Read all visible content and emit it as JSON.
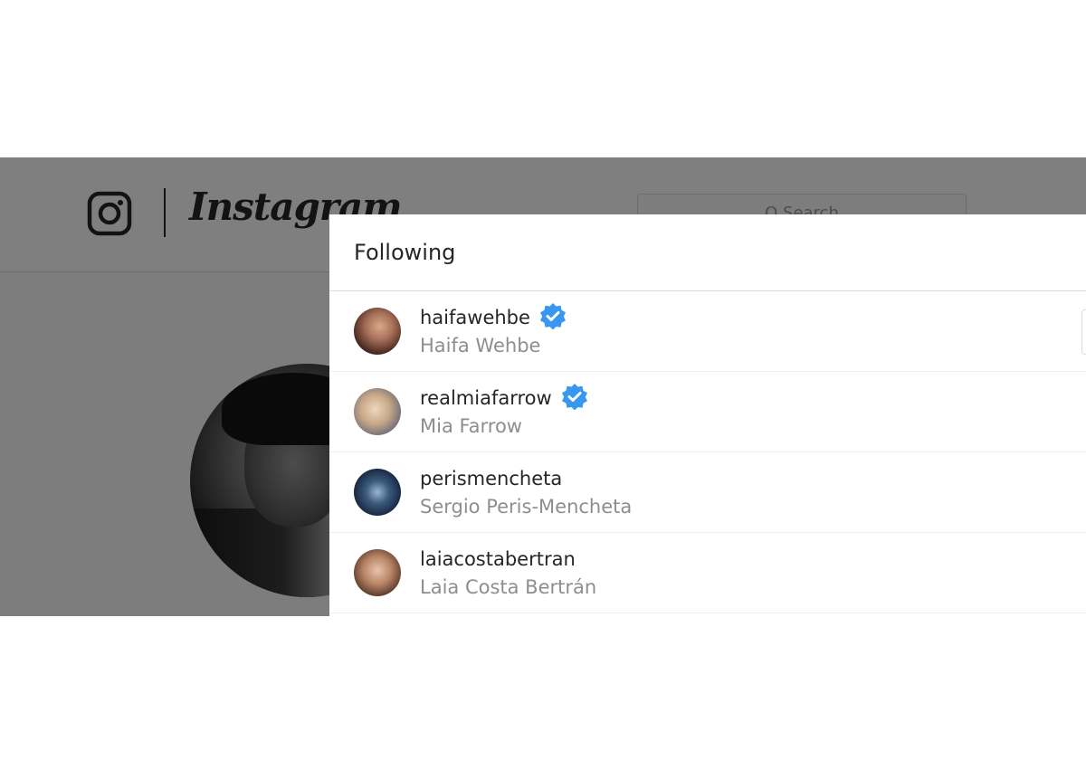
{
  "page": {
    "brand": "Instagram",
    "search_placeholder": "Q Search"
  },
  "modal": {
    "title": "Following",
    "users": [
      {
        "username": "haifawehbe",
        "full_name": "Haifa Wehbe",
        "verified": true
      },
      {
        "username": "realmiafarrow",
        "full_name": "Mia Farrow",
        "verified": true
      },
      {
        "username": "perismencheta",
        "full_name": "Sergio Peris-Mencheta",
        "verified": false
      },
      {
        "username": "laiacostabertran",
        "full_name": "Laia Costa Bertrán",
        "verified": false
      }
    ]
  },
  "colors": {
    "verified_badge": "#3897f0",
    "overlay": "#000000",
    "text_primary": "#262626",
    "text_secondary": "#8e8e8e"
  }
}
